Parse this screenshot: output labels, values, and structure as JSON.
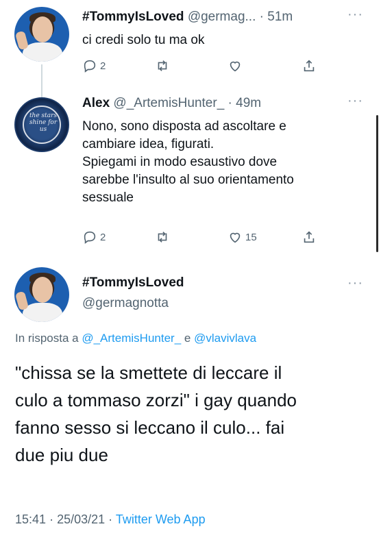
{
  "tweets": [
    {
      "display_name": "#TommyIsLoved",
      "handle": "@germag...",
      "separator": "·",
      "time": "51m",
      "text": "ci credi solo tu ma ok",
      "reply_count": "2",
      "retweet_count": "",
      "like_count": ""
    },
    {
      "display_name": "Alex",
      "handle": "@_ArtemisHunter_",
      "separator": "·",
      "time": "49m",
      "avatar_text": "the stars shine for us",
      "text_lines": [
        "Nono, sono disposta ad ascoltare e",
        "cambiare idea, figurati.",
        "Spiegami in modo esaustivo dove",
        "sarebbe l'insulto al suo orientamento",
        "sessuale"
      ],
      "reply_count": "2",
      "retweet_count": "",
      "like_count": "15"
    }
  ],
  "main_tweet": {
    "display_name": "#TommyIsLoved",
    "handle": "@germagnotta",
    "reply_prefix": "In risposta a",
    "reply_mention_1": "@_ArtemisHunter_",
    "reply_and": "e",
    "reply_mention_2": "@vlavivlava",
    "text_lines": [
      "\"chissa se la smettete di leccare il",
      "culo a tommaso zorzi\" i gay quando",
      "fanno sesso si leccano il culo... fai",
      "due piu due"
    ],
    "time": "15:41",
    "separator": "·",
    "date": "25/03/21",
    "app": "Twitter Web App"
  },
  "icons": {
    "more": "more-icon",
    "reply": "reply-icon",
    "retweet": "retweet-icon",
    "like": "like-icon",
    "share": "share-icon"
  },
  "colors": {
    "accent": "#1d9bf0",
    "secondary_text": "#536471",
    "primary_text": "#0f1419"
  }
}
